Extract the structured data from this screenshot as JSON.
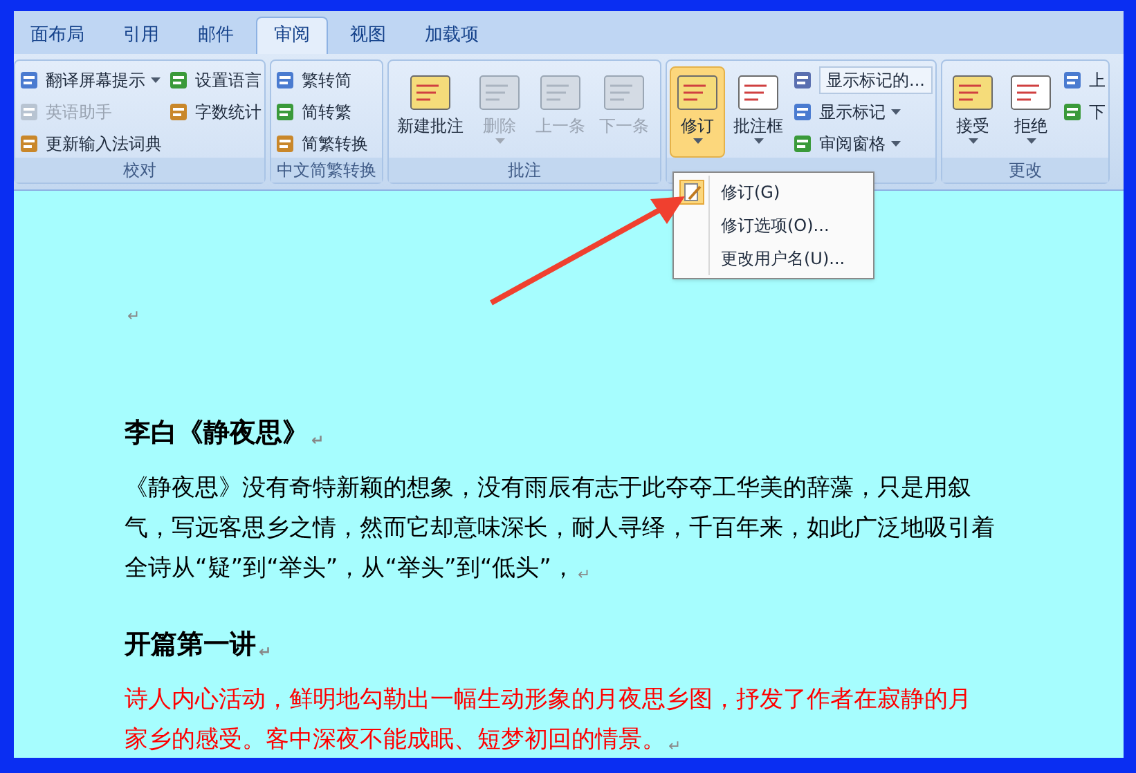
{
  "tabs": [
    {
      "label": "面布局",
      "selected": false
    },
    {
      "label": "引用",
      "selected": false
    },
    {
      "label": "邮件",
      "selected": false
    },
    {
      "label": "审阅",
      "selected": true
    },
    {
      "label": "视图",
      "selected": false
    },
    {
      "label": "加载项",
      "selected": false
    }
  ],
  "groups": [
    {
      "label": "校对",
      "columns": [
        [
          {
            "label": "翻译屏幕提示",
            "disabled": false,
            "dropdown": true
          },
          {
            "label": "英语助手",
            "disabled": true,
            "dropdown": false
          },
          {
            "label": "更新输入法词典",
            "disabled": false,
            "dropdown": false
          }
        ],
        [
          {
            "label": "设置语言",
            "disabled": false,
            "dropdown": false
          },
          {
            "label": "字数统计",
            "disabled": false,
            "dropdown": false
          }
        ]
      ]
    },
    {
      "label": "中文简繁转换",
      "columns": [
        [
          {
            "label": "繁转简",
            "disabled": false,
            "dropdown": false
          },
          {
            "label": "简转繁",
            "disabled": false,
            "dropdown": false
          },
          {
            "label": "简繁转换",
            "disabled": false,
            "dropdown": false
          }
        ]
      ]
    },
    {
      "label": "批注",
      "big": [
        {
          "label": "新建批注",
          "disabled": false,
          "dropdown": false
        },
        {
          "label": "删除",
          "disabled": true,
          "dropdown": true
        },
        {
          "label": "上一条",
          "disabled": true,
          "dropdown": false
        },
        {
          "label": "下一条",
          "disabled": true,
          "dropdown": false
        }
      ]
    },
    {
      "big": [
        {
          "label": "修订",
          "disabled": false,
          "dropdown": true,
          "selected": true
        },
        {
          "label": "批注框",
          "disabled": false,
          "dropdown": true,
          "selected": false
        }
      ],
      "combo": {
        "value": "显示标记的..."
      },
      "columns": [
        [
          {
            "label": "显示标记",
            "disabled": false,
            "dropdown": true
          },
          {
            "label": "审阅窗格",
            "disabled": false,
            "dropdown": true
          }
        ]
      ]
    },
    {
      "label": "更改",
      "big": [
        {
          "label": "接受",
          "disabled": false,
          "dropdown": true
        },
        {
          "label": "拒绝",
          "disabled": false,
          "dropdown": true
        }
      ],
      "columns": [
        [
          {
            "label": "上",
            "disabled": false,
            "dropdown": false
          },
          {
            "label": "下",
            "disabled": false,
            "dropdown": false
          }
        ]
      ]
    }
  ],
  "menu": [
    {
      "label": "修订(G)",
      "checked": true
    },
    {
      "label": "修订选项(O)...",
      "checked": false
    },
    {
      "label": "更改用户名(U)...",
      "checked": false
    }
  ],
  "document": [
    {
      "kind": "empty",
      "mark": "↵"
    },
    {
      "kind": "heading",
      "lines": [
        "李白《静夜思》"
      ],
      "mark": "↵",
      "color": "#000000"
    },
    {
      "kind": "body",
      "lines": [
        "《静夜思》没有奇特新颖的想象，没有雨辰有志于此夺夺工华美的辞藻，只是用叙",
        "气，写远客思乡之情，然而它却意味深长，耐人寻绎，千百年来，如此广泛地吸引着",
        "全诗从“疑”到“举头”，从“举头”到“低头”，"
      ],
      "mark": "↵",
      "color": "#000000"
    },
    {
      "kind": "heading",
      "lines": [
        "开篇第一讲"
      ],
      "mark": "↵",
      "color": "#000000"
    },
    {
      "kind": "body",
      "lines": [
        "诗人内心活动，鲜明地勾勒出一幅生动形象的月夜思乡图，抒发了作者在寂静的月",
        "家乡的感受。客中深夜不能成眠、短梦初回的情景。"
      ],
      "mark": "↵",
      "color": "#ff0000"
    }
  ]
}
